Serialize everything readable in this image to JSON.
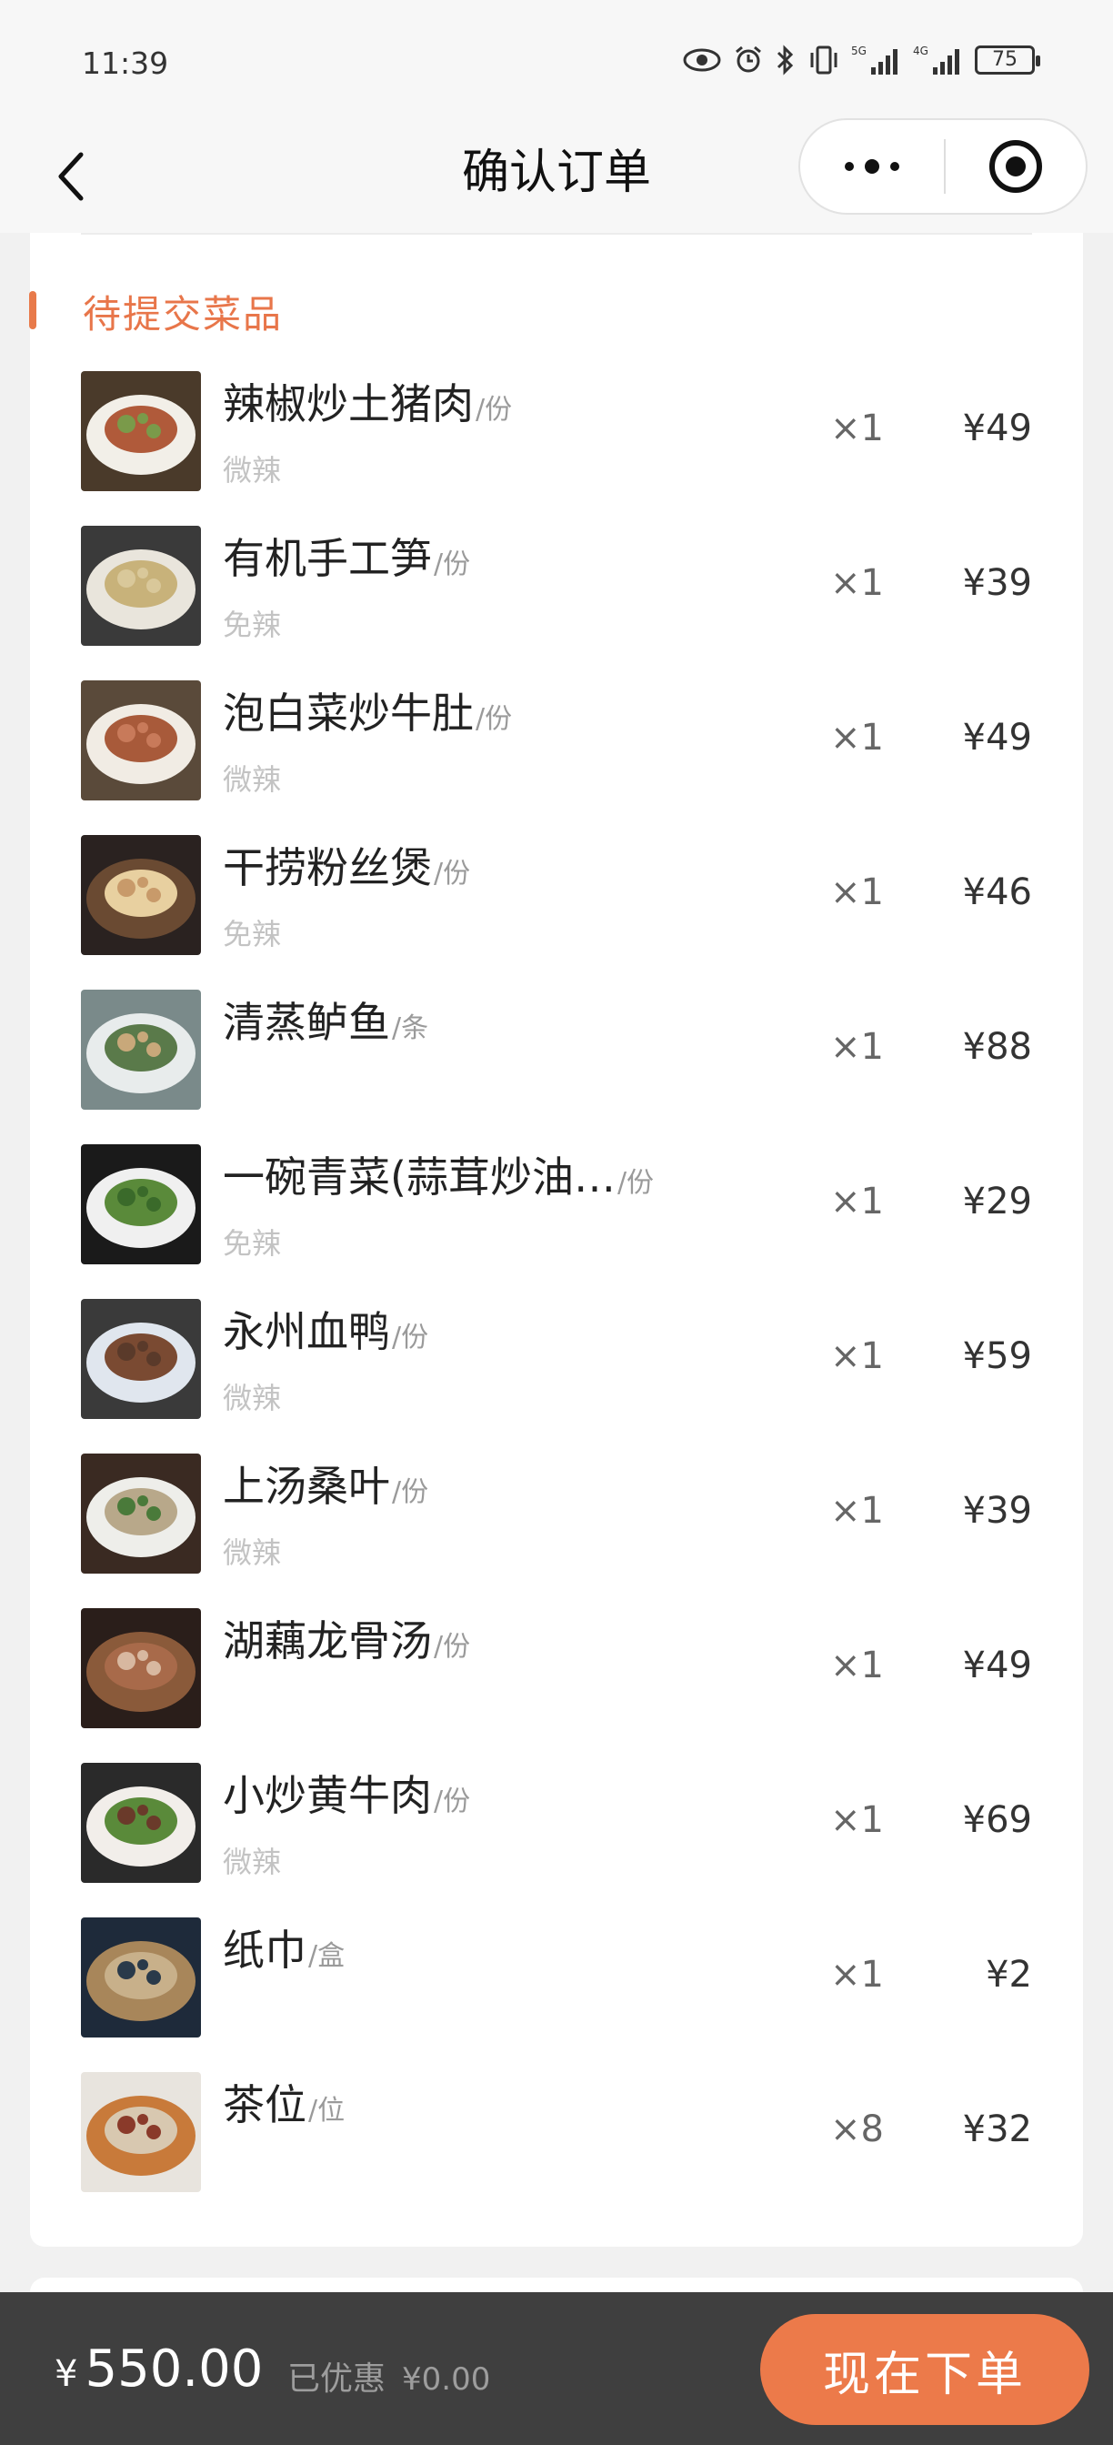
{
  "status": {
    "time": "11:39",
    "network1": "5G",
    "network2": "4G",
    "battery": "75"
  },
  "nav": {
    "title": "确认订单"
  },
  "section": {
    "title": "待提交菜品"
  },
  "items": [
    {
      "name": "辣椒炒土猪肉",
      "unit": "/份",
      "spice": "微辣",
      "qty": "×1",
      "price": "¥49",
      "thumb_colors": [
        "#4a3a2a",
        "#f2efe8",
        "#7a9a4a",
        "#b05a3a"
      ]
    },
    {
      "name": "有机手工笋",
      "unit": "/份",
      "spice": "免辣",
      "qty": "×1",
      "price": "¥39",
      "thumb_colors": [
        "#3a3a3a",
        "#e9e5dc",
        "#d9c89a",
        "#c8b27a"
      ]
    },
    {
      "name": "泡白菜炒牛肚",
      "unit": "/份",
      "spice": "微辣",
      "qty": "×1",
      "price": "¥49",
      "thumb_colors": [
        "#5a4a3a",
        "#f1ece4",
        "#c87a5a",
        "#a85a3a"
      ]
    },
    {
      "name": "干捞粉丝煲",
      "unit": "/份",
      "spice": "免辣",
      "qty": "×1",
      "price": "¥46",
      "thumb_colors": [
        "#2a2220",
        "#6a4a32",
        "#c89a6a",
        "#e8d0a0"
      ]
    },
    {
      "name": "清蒸鲈鱼",
      "unit": "/条",
      "spice": "",
      "qty": "×1",
      "price": "¥88",
      "thumb_colors": [
        "#7a8a8a",
        "#e8ecec",
        "#c8a87a",
        "#5a7a4a"
      ]
    },
    {
      "name": "一碗青菜(蒜茸炒油…",
      "unit": "/份",
      "spice": "免辣",
      "qty": "×1",
      "price": "¥29",
      "thumb_colors": [
        "#1a1a1a",
        "#f0f0f0",
        "#3a6a2a",
        "#5a8a3a"
      ]
    },
    {
      "name": "永州血鸭",
      "unit": "/份",
      "spice": "微辣",
      "qty": "×1",
      "price": "¥59",
      "thumb_colors": [
        "#3a3a3a",
        "#e0e6ee",
        "#5a3a2a",
        "#7a4a32"
      ]
    },
    {
      "name": "上汤桑叶",
      "unit": "/份",
      "spice": "微辣",
      "qty": "×1",
      "price": "¥39",
      "thumb_colors": [
        "#3a2a22",
        "#eeeeea",
        "#4a7a3a",
        "#b8a88a"
      ]
    },
    {
      "name": "湖藕龙骨汤",
      "unit": "/份",
      "spice": "",
      "qty": "×1",
      "price": "¥49",
      "thumb_colors": [
        "#2a1e1a",
        "#8a5a3a",
        "#d8b8a0",
        "#a86a4a"
      ]
    },
    {
      "name": "小炒黄牛肉",
      "unit": "/份",
      "spice": "微辣",
      "qty": "×1",
      "price": "¥69",
      "thumb_colors": [
        "#2a2a2a",
        "#f2eeea",
        "#6a3a2a",
        "#5a8a3a"
      ]
    },
    {
      "name": "纸巾",
      "unit": "/盒",
      "spice": "",
      "qty": "×1",
      "price": "¥2",
      "thumb_colors": [
        "#1e2a3a",
        "#a8865a",
        "#2a3a4a",
        "#c8b08a"
      ]
    },
    {
      "name": "茶位",
      "unit": "/位",
      "spice": "",
      "qty": "×8",
      "price": "¥32",
      "thumb_colors": [
        "#e8e4de",
        "#c87a3a",
        "#8a3a2a",
        "#d8c8b0"
      ]
    }
  ],
  "footer": {
    "currency": "¥",
    "total": "550.00",
    "discount_label": "已优惠",
    "discount_amount": "¥0.00",
    "order_button": "现在下单"
  },
  "colors": {
    "accent": "#ec7a4a",
    "bottom_bar": "#3f3f3f"
  }
}
